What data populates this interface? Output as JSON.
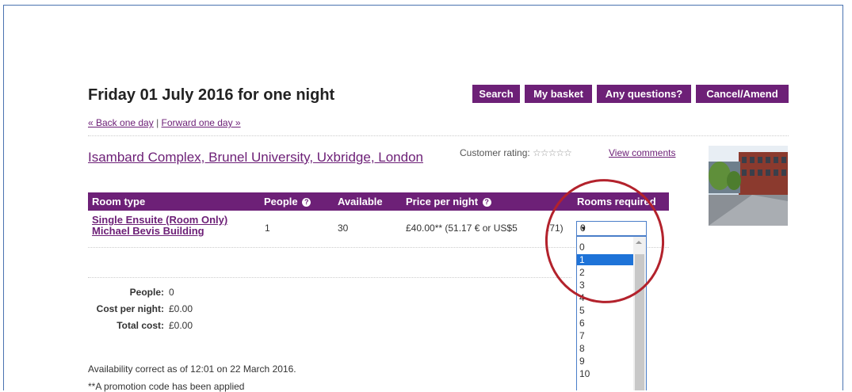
{
  "header": {
    "title": "Friday 01 July 2016 for one night",
    "buttons": [
      "Search",
      "My basket",
      "Any questions?",
      "Cancel/Amend"
    ]
  },
  "daynav": {
    "back": "« Back one day",
    "separator": "|",
    "forward": "Forward one day »"
  },
  "property": {
    "name": "Isambard Complex, Brunel University, Uxbridge, London",
    "rating_label": "Customer rating:",
    "stars": "☆☆☆☆☆",
    "view_comments": "View comments"
  },
  "table": {
    "columns": [
      "Room type",
      "People",
      "Available",
      "Price per night",
      "Rooms required"
    ],
    "help_icon": "?",
    "rows": [
      {
        "room_line1": "Single Ensuite (Room Only)",
        "room_line2": "Michael Bevis Building",
        "people": "1",
        "available": "30",
        "price": "£40.00**  (51.17 € or US$5",
        "price_tail": ".71)",
        "rooms_selected": "0"
      }
    ]
  },
  "dropdown": {
    "options": [
      "0",
      "1",
      "2",
      "3",
      "4",
      "5",
      "6",
      "7",
      "8",
      "9",
      "10"
    ],
    "highlighted": "1"
  },
  "summary": {
    "people_label": "People:",
    "people_value": "0",
    "cost_label": "Cost per night:",
    "cost_value": "£0.00",
    "total_label": "Total cost:",
    "total_value": "£0.00"
  },
  "notes": {
    "availability": "Availability correct as of 12:01 on 22 March 2016.",
    "promo": "**A promotion code has been applied"
  },
  "colors": {
    "brand": "#6d2077",
    "highlight": "#1e73d8",
    "annotation": "#b3222c"
  }
}
